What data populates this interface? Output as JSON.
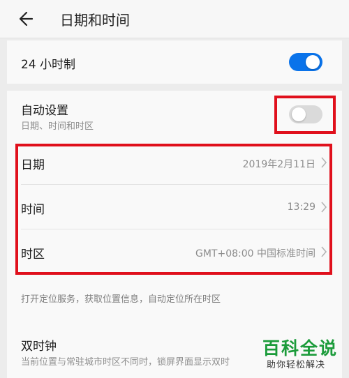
{
  "header": {
    "title": "日期和时间",
    "back_icon": "arrow-left-icon"
  },
  "rows": {
    "hour24": {
      "label": "24 小时制",
      "toggle": true
    },
    "auto": {
      "label": "自动设置",
      "subtitle": "日期、时间和时区",
      "toggle": false
    },
    "date": {
      "label": "日期",
      "value": "2019年2月11日"
    },
    "time": {
      "label": "时间",
      "value": "13:29"
    },
    "timezone": {
      "label": "时区",
      "value": "GMT+08:00 中国标准时间"
    }
  },
  "hint": "打开定位服务，获取位置信息，自动定位所在时区",
  "dual_clock": {
    "label": "双时钟",
    "subtitle": "当前位置与常驻城市时区不同时，锁屏界面显示双时"
  },
  "watermark": {
    "title": "百科全说",
    "subtitle": "助你轻松解决"
  },
  "colors": {
    "accent": "#0a73ea",
    "highlight": "#e0101c",
    "watermark": "#1b9b3a"
  }
}
